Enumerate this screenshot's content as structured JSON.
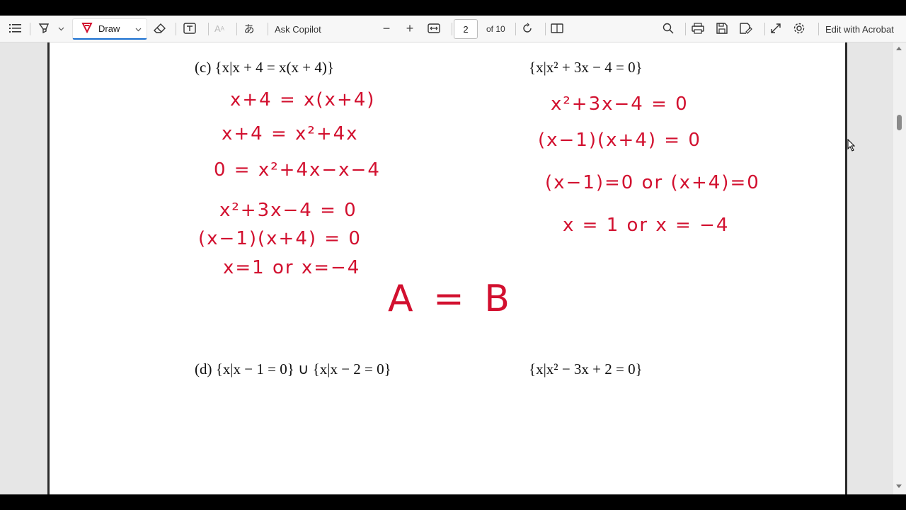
{
  "toolbar": {
    "draw_label": "Draw",
    "ask_copilot_label": "Ask Copilot",
    "zoom_out": "−",
    "zoom_in": "+",
    "page_number": "2",
    "page_total": "of 10",
    "edit_acrobat_label": "Edit with Acrobat",
    "accent_color": "#1a6fd0",
    "draw_pen_color": "#d2102f"
  },
  "document": {
    "problem_c_left": "(c) {x|x + 4 = x(x + 4)}",
    "problem_c_right": "{x|x² + 3x − 4 = 0}",
    "problem_d_left": "(d) {x|x − 1 = 0} ∪ {x|x − 2 = 0}",
    "problem_d_right": "{x|x² − 3x + 2 = 0}"
  },
  "handwriting": {
    "ink_color": "#d2102f",
    "left_lines": [
      "x+4 = x(x+4)",
      "x+4 = x²+4x",
      "0 = x²+4x−x−4",
      "x²+3x−4 = 0",
      "(x−1)(x+4) = 0",
      "x=1  or  x=−4"
    ],
    "right_lines": [
      "x²+3x−4 = 0",
      "(x−1)(x+4) = 0",
      "(x−1)=0  or  (x+4)=0",
      "x = 1   or   x = −4"
    ],
    "conclusion": "A = B"
  }
}
